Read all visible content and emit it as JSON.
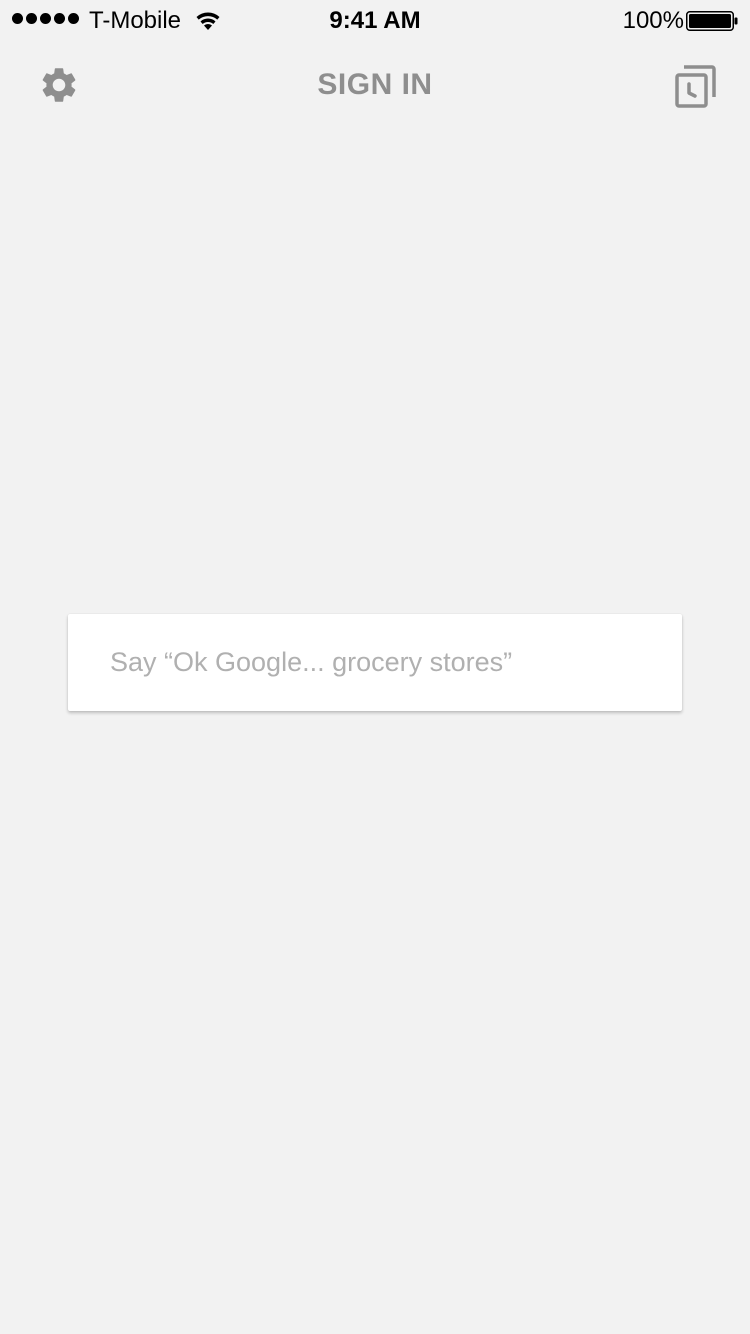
{
  "status_bar": {
    "carrier": "T-Mobile",
    "time": "9:41 AM",
    "battery_percent": "100%",
    "signal_bars": 5,
    "icons": [
      "signal-dots-icon",
      "wifi-icon",
      "battery-icon"
    ]
  },
  "header": {
    "sign_in_label": "SIGN IN",
    "left_icon": "gear-icon",
    "right_icon": "history-icon",
    "icon_color": "#8e8e8e"
  },
  "search": {
    "placeholder": "Say “Ok Google... grocery stores”",
    "value": ""
  },
  "colors": {
    "background": "#f2f2f2",
    "card": "#ffffff",
    "placeholder": "#b0b0b0"
  }
}
